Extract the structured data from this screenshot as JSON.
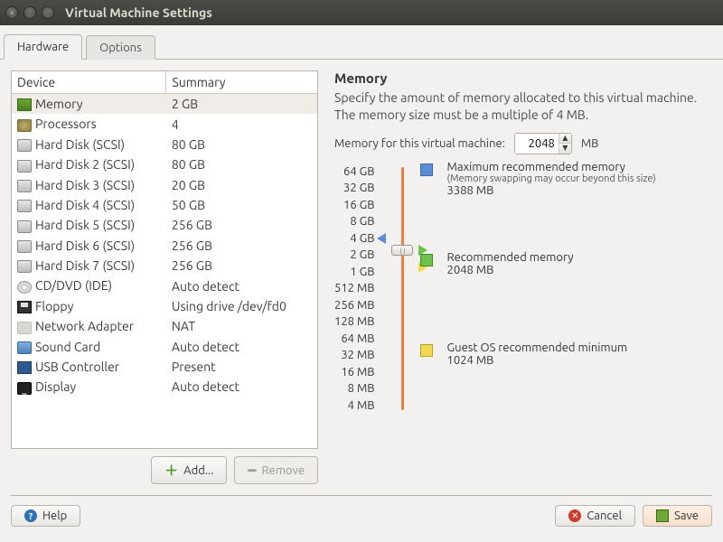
{
  "window": {
    "title": "Virtual Machine Settings"
  },
  "tabs": {
    "hardware": "Hardware",
    "options": "Options"
  },
  "table": {
    "col_device": "Device",
    "col_summary": "Summary",
    "rows": [
      {
        "device": "Memory",
        "summary": "2 GB",
        "icon": "mem",
        "selected": true
      },
      {
        "device": "Processors",
        "summary": "4",
        "icon": "cpu"
      },
      {
        "device": "Hard Disk (SCSI)",
        "summary": "80 GB",
        "icon": "hdd"
      },
      {
        "device": "Hard Disk 2 (SCSI)",
        "summary": "80 GB",
        "icon": "hdd"
      },
      {
        "device": "Hard Disk 3 (SCSI)",
        "summary": "20 GB",
        "icon": "hdd"
      },
      {
        "device": "Hard Disk 4 (SCSI)",
        "summary": "50 GB",
        "icon": "hdd"
      },
      {
        "device": "Hard Disk 5 (SCSI)",
        "summary": "256 GB",
        "icon": "hdd"
      },
      {
        "device": "Hard Disk 6 (SCSI)",
        "summary": "256 GB",
        "icon": "hdd"
      },
      {
        "device": "Hard Disk 7 (SCSI)",
        "summary": "256 GB",
        "icon": "hdd"
      },
      {
        "device": "CD/DVD (IDE)",
        "summary": "Auto detect",
        "icon": "cd"
      },
      {
        "device": "Floppy",
        "summary": "Using drive /dev/fd0",
        "icon": "floppy"
      },
      {
        "device": "Network Adapter",
        "summary": "NAT",
        "icon": "net"
      },
      {
        "device": "Sound Card",
        "summary": "Auto detect",
        "icon": "snd"
      },
      {
        "device": "USB Controller",
        "summary": "Present",
        "icon": "usb"
      },
      {
        "device": "Display",
        "summary": "Auto detect",
        "icon": "dsp"
      }
    ]
  },
  "buttons": {
    "add": "Add...",
    "remove": "Remove",
    "help": "Help",
    "cancel": "Cancel",
    "save": "Save"
  },
  "memory": {
    "title": "Memory",
    "desc": "Specify the amount of memory allocated to this virtual machine. The memory size must be a multiple of 4 MB.",
    "field_label_prefix": "Memory for this virtual machine:",
    "field_unit": "MB",
    "field_value": "2048",
    "ticks": [
      "64 GB",
      "32 GB",
      "16 GB",
      "8 GB",
      "4 GB",
      "2 GB",
      "1 GB",
      "512 MB",
      "256 MB",
      "128 MB",
      "64 MB",
      "32 MB",
      "16 MB",
      "8 MB",
      "4 MB"
    ],
    "markers": {
      "max": {
        "label": "Maximum recommended memory",
        "note": "(Memory swapping may occur beyond this size)",
        "value": "3388 MB"
      },
      "rec": {
        "label": "Recommended memory",
        "value": "2048 MB"
      },
      "guest": {
        "label": "Guest OS recommended minimum",
        "value": "1024 MB"
      }
    }
  }
}
